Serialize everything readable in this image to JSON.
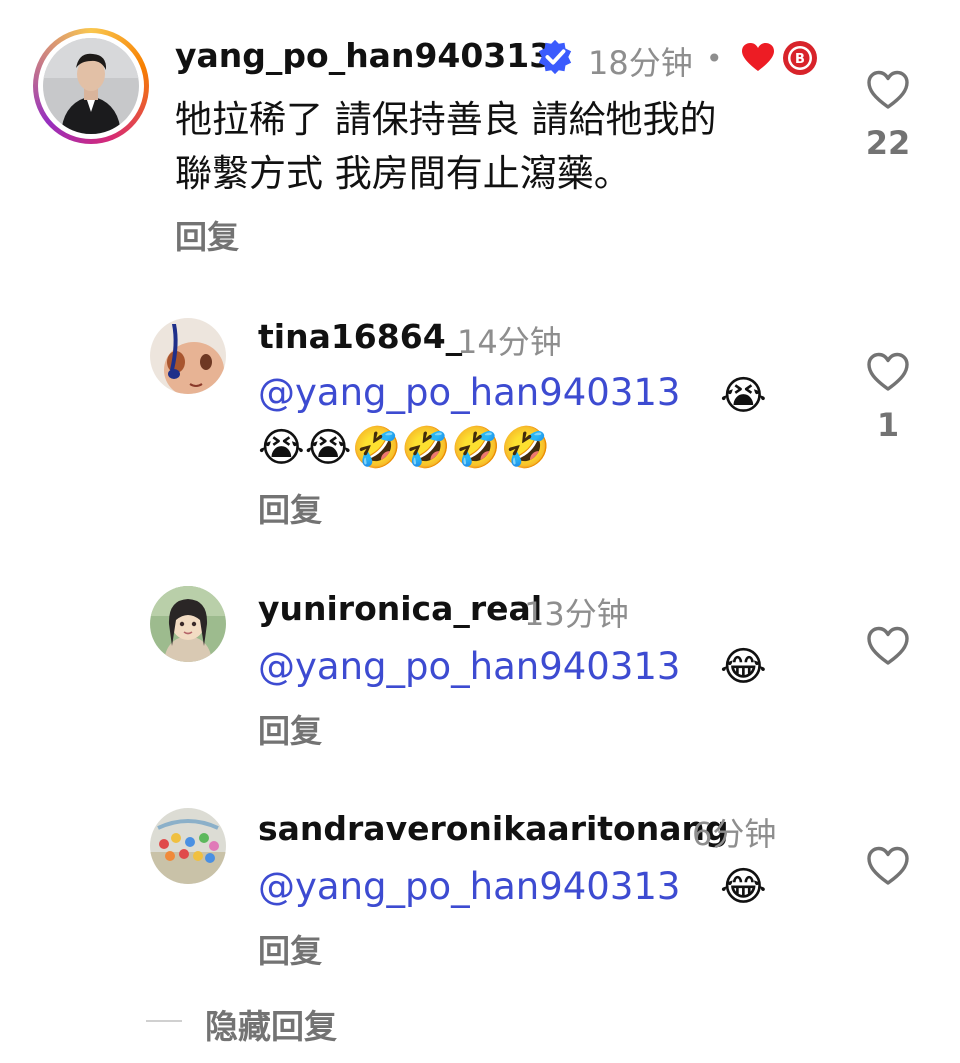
{
  "main_comment": {
    "username": "yang_po_han940313",
    "verified_icon": "verified-badge-icon",
    "time": "18分钟",
    "separator": "•",
    "liked_by_creator_icon": "red-heart-icon",
    "creator_badge_icon": "creator-avatar-badge",
    "text_line1": "牠拉稀了 請保持善良 請給牠我的",
    "text_line2": "聯繫方式 我房間有止瀉藥。",
    "reply_label": "回复",
    "like_count": "22"
  },
  "replies": [
    {
      "username": "tina16864_",
      "time": "14分钟",
      "mention": "@yang_po_han940313",
      "emoji_inline": "😭",
      "emoji_line": "😭😭🤣🤣🤣🤣",
      "reply_label": "回复",
      "like_count": "1"
    },
    {
      "username": "yunironica_real",
      "time": "13分钟",
      "mention": "@yang_po_han940313",
      "emoji_inline": "😂",
      "reply_label": "回复",
      "like_count": ""
    },
    {
      "username": "sandraveronikaaritonang",
      "time": "6分钟",
      "mention": "@yang_po_han940313",
      "emoji_inline": "😂",
      "reply_label": "回复",
      "like_count": ""
    }
  ],
  "hide_replies_label": "隐藏回复",
  "colors": {
    "mention": "#3d4bd1",
    "meta": "#8e8e8e",
    "reply": "#737373",
    "verified": "#3b5bfd",
    "liked": "#ed1c24"
  }
}
